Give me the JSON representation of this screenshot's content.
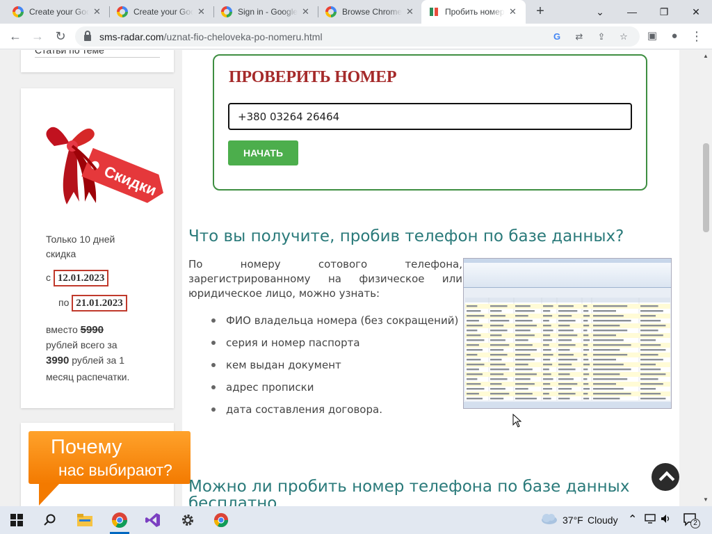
{
  "browser": {
    "tabs": [
      {
        "title": "Create your Goo",
        "icon": "google-icon"
      },
      {
        "title": "Create your Goo",
        "icon": "google-icon"
      },
      {
        "title": "Sign in - Google",
        "icon": "google-icon"
      },
      {
        "title": "Browse Chrome",
        "icon": "google-icon"
      },
      {
        "title": "Пробить номер",
        "icon": "sms-radar-icon",
        "active": true
      }
    ],
    "url_host": "sms-radar.com",
    "url_path": "/uznat-fio-cheloveka-po-nomeru.html"
  },
  "sidebar": {
    "articles_link": "Статьи по теме",
    "promo": {
      "ribbon_text": "Скидки",
      "line1": "Только 10 дней",
      "line2": "скидка",
      "from_label": "с",
      "from_date": "12.01.2023",
      "to_label": "по",
      "to_date": "21.01.2023",
      "instead_label": "вместо",
      "old_price": "5990",
      "line_rubles_total": "рублей всего за",
      "new_price": "3990",
      "line_rubles_month": "рублей за 1",
      "line_printouts": "месяц распечатки."
    },
    "why_banner": {
      "line1": "Почему",
      "line2": "нас выбирают?"
    }
  },
  "check_form": {
    "title": "ПРОВЕРИТЬ НОМЕР",
    "phone_value": "+380 03264 26464",
    "submit_label": "НАЧАТЬ"
  },
  "content": {
    "heading1": "Что вы получите, пробив телефон по базе данных?",
    "paragraph": "По номеру сотового телефона, зарегистрированному на физическое или юридическое лицо, можно узнать:",
    "bullets": [
      "ФИО владельца номера (без сокращений)",
      "серия и номер паспорта",
      "кем выдан документ",
      "адрес прописки",
      "дата составления договора."
    ],
    "heading2": "Можно ли пробить номер телефона по базе данных бесплатно"
  },
  "taskbar": {
    "weather_temp": "37°F",
    "weather_desc": "Cloudy",
    "notifications_count": "2"
  },
  "colors": {
    "heading": "#2a7a7a",
    "check_title": "#a52a2a",
    "button_green": "#4cae4c",
    "form_border": "#3e8e41",
    "date_border": "#c0392b",
    "banner_orange": "#f37a00"
  }
}
